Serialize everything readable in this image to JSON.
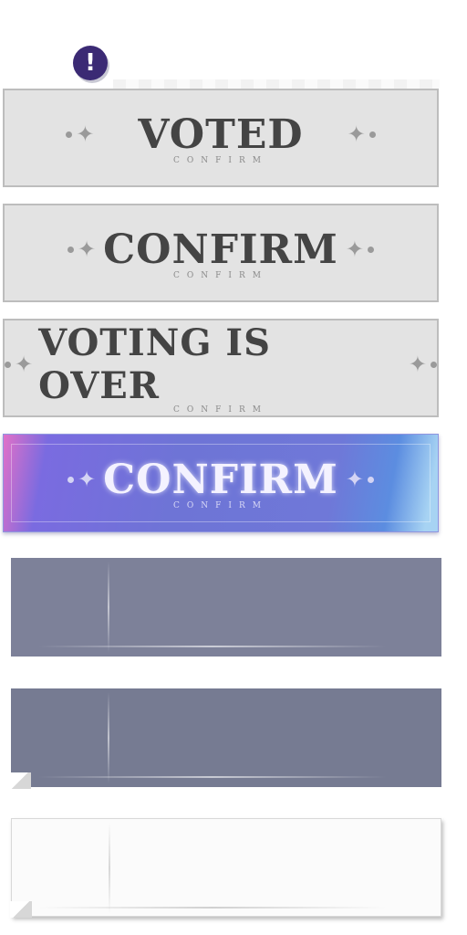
{
  "alert": {
    "icon": "exclamation-icon",
    "glyph": "!"
  },
  "buttons": [
    {
      "label": "VOTED",
      "sub": "CONFIRM"
    },
    {
      "label": "CONFIRM",
      "sub": "CONFIRM"
    },
    {
      "label": "VOTING IS OVER",
      "sub": "CONFIRM"
    },
    {
      "label": "CONFIRM",
      "sub": "CONFIRM"
    }
  ],
  "decor": {
    "star": "✦"
  },
  "colors": {
    "disabled_bg": "#e3e3e3",
    "active_accent": "#6e74d6",
    "panel_dark": "#7d8199",
    "panel_light": "#fbfbfb"
  }
}
